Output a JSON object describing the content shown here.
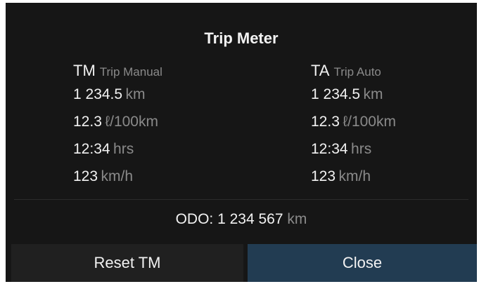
{
  "dialog": {
    "title": "Trip Meter"
  },
  "trip_manual": {
    "abbr": "TM",
    "name": "Trip Manual",
    "rows": [
      {
        "value": "1 234.5",
        "unit": "km"
      },
      {
        "value": "12.3",
        "unit": "ℓ/100km"
      },
      {
        "value": "12:34",
        "unit": "hrs"
      },
      {
        "value": "123",
        "unit": "km/h"
      }
    ]
  },
  "trip_auto": {
    "abbr": "TA",
    "name": "Trip Auto",
    "rows": [
      {
        "value": "1 234.5",
        "unit": "km"
      },
      {
        "value": "12.3",
        "unit": "ℓ/100km"
      },
      {
        "value": "12:34",
        "unit": "hrs"
      },
      {
        "value": "123",
        "unit": "km/h"
      }
    ]
  },
  "odometer": {
    "label": "ODO:",
    "value": "1 234 567",
    "unit": "km"
  },
  "buttons": {
    "reset_label": "Reset TM",
    "close_label": "Close"
  },
  "colors": {
    "background": "#161616",
    "text": "#f2f2f2",
    "muted_text": "#8a8a8a",
    "close_button": "#223c52",
    "reset_button": "#202020"
  }
}
